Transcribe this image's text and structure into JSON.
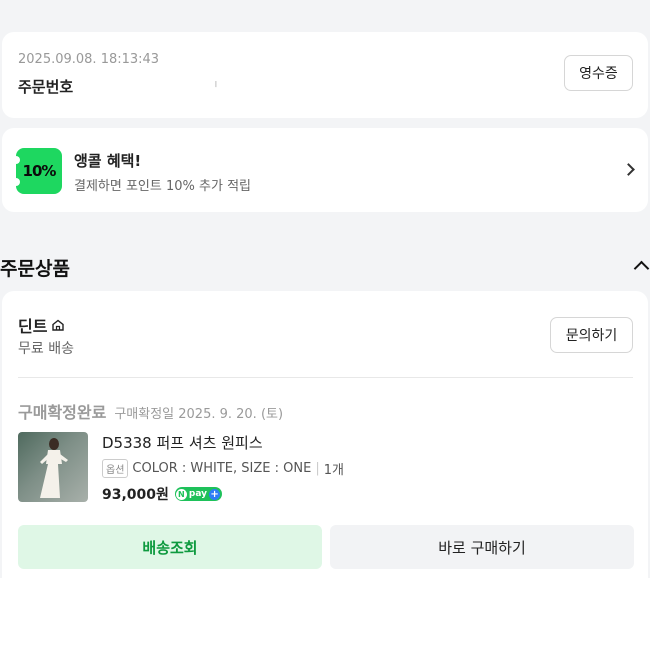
{
  "order": {
    "date": "2025.09.08. 18:13:43",
    "label": "주문번호",
    "number": "ᅵ",
    "receipt_button": "영수증"
  },
  "benefit": {
    "badge": "10%",
    "title": "앵콜 혜택!",
    "description": "결제하면 포인트 10% 추가 적립",
    "badge_color": "#1ed760"
  },
  "section": {
    "title": "주문상품"
  },
  "product_card": {
    "store_name": "딘트",
    "shipping": "무료 배송",
    "inquiry_button": "문의하기",
    "status": "구매확정완료",
    "status_date": "구매확정일 2025. 9. 20. (토)",
    "product_name": "D5338 퍼프 셔츠 원피스",
    "option_tag": "옵션",
    "option_text": "COLOR : WHITE, SIZE : ONE",
    "quantity": "1개",
    "price": "93,000원",
    "npay_label": "pay",
    "track_button": "배송조회",
    "buy_again_button": "바로 구매하기",
    "accent_color": "#0e9a3f"
  }
}
